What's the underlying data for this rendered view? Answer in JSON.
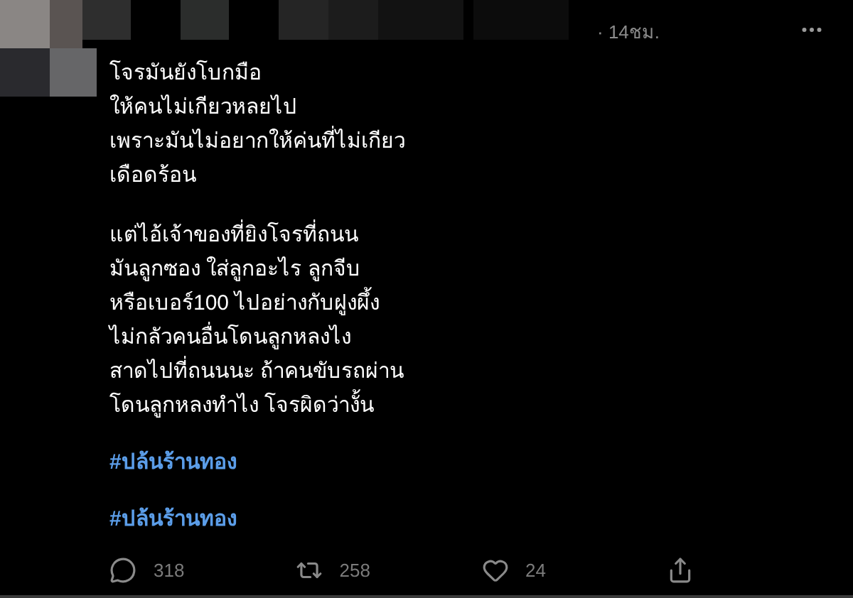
{
  "tweet": {
    "timestamp": "· 14ชม.",
    "paragraphs": [
      "โจรมันยังโบกมือ\nให้คนไม่เกียวหลยไป\nเพราะมันไม่อยากให้ค่นที่ไม่เกียว\nเดือดร้อน",
      "แต่ไอ้เจ้าของที่ยิงโจรที่ถนน\nมันลูกซอง ใส่ลูกอะไร ลูกจีบ\nหรือเบอร์100 ไปอย่างกับฝูงผึ้ง\nไม่กลัวคนอื่นโดนลูกหลงไง\nสาดไปที่ถนนนะ ถ้าคนขับรถผ่าน\nโดนลูกหลงทำไง โจรผิดว่างั้น"
    ],
    "hashtags": [
      "#ปล้นร้านทอง",
      "#ปล้นร้านทอง"
    ],
    "actions": [
      {
        "kind": "reply",
        "count": "318"
      },
      {
        "kind": "retweet",
        "count": "258"
      },
      {
        "kind": "like",
        "count": "24"
      },
      {
        "kind": "share"
      }
    ]
  }
}
